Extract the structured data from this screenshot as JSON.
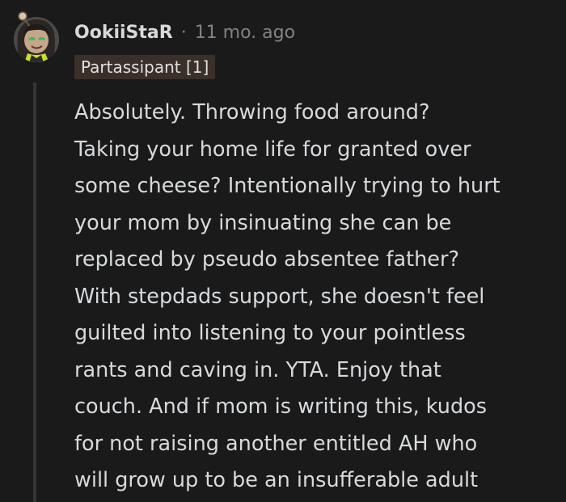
{
  "comment": {
    "username": "OokiiStaR",
    "separator": "·",
    "timestamp": "11 mo. ago",
    "flair": "Partassipant [1]",
    "body_lines": [
      "Absolutely. Throwing food around?",
      "Taking your home life for granted over",
      "some cheese? Intentionally trying to hurt",
      "your mom by insinuating she can be",
      "replaced by pseudo absentee father?",
      "With stepdads support, she doesn't feel",
      "guilted into listening to your pointless",
      "rants and caving in. YTA. Enjoy that",
      "couch. And if mom is writing this, kudos",
      "for not raising another entitled AH who",
      "will grow up to be an insufferable adult"
    ]
  },
  "colors": {
    "background": "#1a1a1b",
    "text": "#d7dadc",
    "muted": "#818384",
    "flair_background": "#3b2f2a",
    "thread_line": "#343536"
  }
}
